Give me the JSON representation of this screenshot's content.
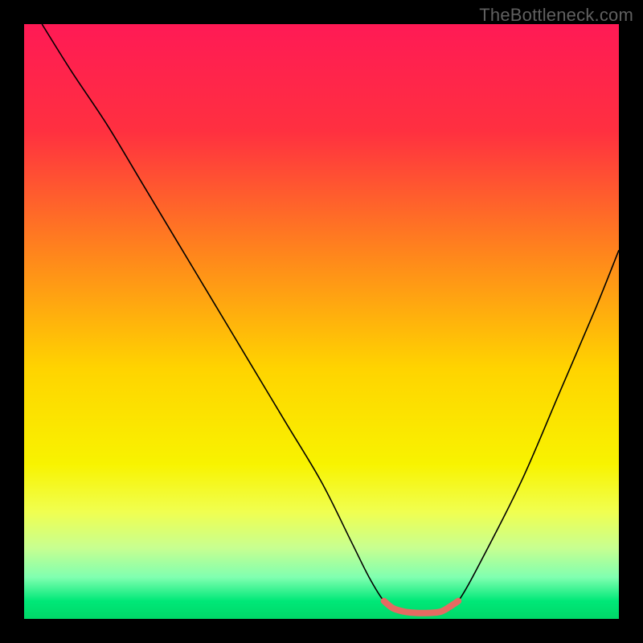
{
  "watermark": "TheBottleneck.com",
  "chart_data": {
    "type": "line",
    "title": "",
    "xlabel": "",
    "ylabel": "",
    "xlim": [
      0,
      100
    ],
    "ylim": [
      0,
      100
    ],
    "grid": false,
    "background_gradient": {
      "stops": [
        {
          "offset": 0,
          "color": "#ff1a55"
        },
        {
          "offset": 18,
          "color": "#ff3040"
        },
        {
          "offset": 40,
          "color": "#ff8b1a"
        },
        {
          "offset": 58,
          "color": "#ffd400"
        },
        {
          "offset": 74,
          "color": "#f8f300"
        },
        {
          "offset": 82,
          "color": "#f0ff50"
        },
        {
          "offset": 88,
          "color": "#c8ff90"
        },
        {
          "offset": 93,
          "color": "#80ffb0"
        },
        {
          "offset": 97,
          "color": "#00e878"
        },
        {
          "offset": 100,
          "color": "#00d868"
        }
      ]
    },
    "series": [
      {
        "name": "bottleneck-curve",
        "stroke": "#000000",
        "stroke_width": 1.6,
        "x": [
          3,
          8,
          14,
          20,
          26,
          32,
          38,
          44,
          50,
          55,
          58,
          60.5,
          63,
          67,
          70,
          73,
          78,
          84,
          90,
          96,
          100
        ],
        "values": [
          100,
          92,
          83,
          73,
          63,
          53,
          43,
          33,
          23,
          13,
          7,
          3,
          1,
          1,
          1,
          3,
          12,
          24,
          38,
          52,
          62
        ]
      }
    ],
    "optimal_range": {
      "name": "optimal-segment",
      "stroke": "#e66a62",
      "stroke_width": 8,
      "x": [
        60.5,
        62,
        64,
        66,
        68,
        70,
        71.5,
        73
      ],
      "values": [
        3,
        1.8,
        1.2,
        1.0,
        1.0,
        1.2,
        2.0,
        3
      ]
    }
  }
}
